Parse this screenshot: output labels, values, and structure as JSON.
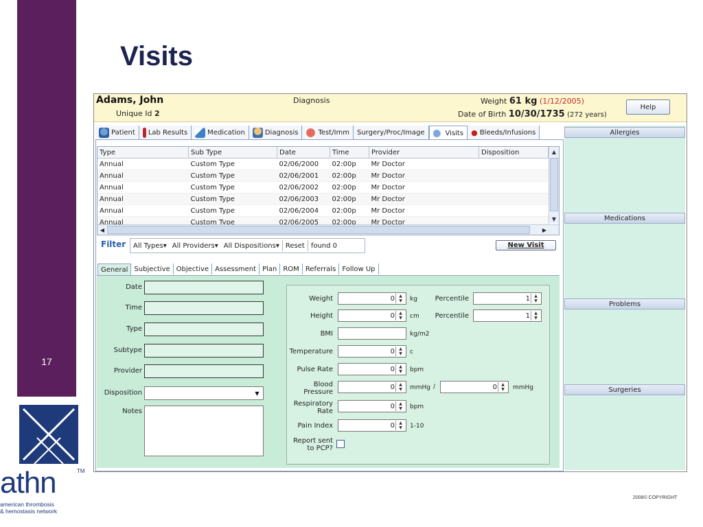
{
  "slide": {
    "title": "Visits",
    "slide_number": "17",
    "copyright": "2008© COPYRIGHT",
    "logo": {
      "word": "athn",
      "tm": "TM",
      "subtitle_line1": "american thrombosis",
      "subtitle_line2": "& hemostasis network"
    },
    "colors": {
      "side_band": "#5a1f5c",
      "title": "#1c2350",
      "logo": "#1e3a7a"
    }
  },
  "patient": {
    "name": "Adams, John",
    "unique_id_label": "Unique Id",
    "unique_id": "2",
    "diagnosis_label": "Diagnosis",
    "weight_label": "Weight",
    "weight": "61 kg",
    "weight_date": "(1/12/2005)",
    "dob_label": "Date of Birth",
    "dob": "10/30/1735",
    "age": "(272 years)",
    "help_button": "Help"
  },
  "tabs": [
    {
      "label": "Patient",
      "icon": "patient-icon",
      "color": "#3b6fb5"
    },
    {
      "label": "Lab Results",
      "icon": "lab-results-icon",
      "color": "#b52a2a"
    },
    {
      "label": "Medication",
      "icon": "medication-icon",
      "color": "#3f7fc9"
    },
    {
      "label": "Diagnosis",
      "icon": "diagnosis-icon",
      "color": "#d9a441"
    },
    {
      "label": "Test/Imm",
      "icon": "test-imm-icon",
      "color": "#d8453b"
    },
    {
      "label": "Surgery/Proc/Image",
      "icon": "",
      "color": ""
    },
    {
      "label": "Visits",
      "icon": "visits-icon",
      "color": "#4a78b8"
    },
    {
      "label": "Bleeds/Infusions",
      "icon": "blood-drop-icon",
      "color": "#c0221f"
    }
  ],
  "active_tab": "Visits",
  "visits_table": {
    "columns": [
      "Type",
      "Sub Type",
      "Date",
      "Time",
      "Provider",
      "Disposition"
    ],
    "rows": [
      [
        "Annual",
        "Custom Type",
        "02/06/2000",
        "02:00p",
        "Mr Doctor",
        ""
      ],
      [
        "Annual",
        "Custom Type",
        "02/06/2001",
        "02:00p",
        "Mr Doctor",
        ""
      ],
      [
        "Annual",
        "Custom Type",
        "02/06/2002",
        "02:00p",
        "Mr Doctor",
        ""
      ],
      [
        "Annual",
        "Custom Type",
        "02/06/2003",
        "02:00p",
        "Mr Doctor",
        ""
      ],
      [
        "Annual",
        "Custom Type",
        "02/06/2004",
        "02:00p",
        "Mr Doctor",
        ""
      ],
      [
        "Annual",
        "Custom Type",
        "02/06/2005",
        "02:00p",
        "Mr Doctor",
        ""
      ]
    ]
  },
  "filter": {
    "label": "Filter",
    "types": "All Types▾",
    "providers": "All Providers▾",
    "dispositions": "All Dispositions▾",
    "reset": "Reset",
    "found": "found 0",
    "new_visit": "New Visit"
  },
  "sub_tabs": [
    "General",
    "Subjective",
    "Objective",
    "Assessment",
    "Plan",
    "ROM",
    "Referrals",
    "Follow Up"
  ],
  "active_sub_tab": "General",
  "general_form": {
    "date_label": "Date",
    "time_label": "Time",
    "type_label": "Type",
    "subtype_label": "Subtype",
    "provider_label": "Provider",
    "disposition_label": "Disposition",
    "notes_label": "Notes",
    "date_value": "",
    "time_value": "",
    "type_value": "",
    "subtype_value": "",
    "provider_value": "",
    "disposition_value": "",
    "notes_value": ""
  },
  "vitals": {
    "weight_label": "Weight",
    "weight_value": "0",
    "weight_unit": "kg",
    "weight_percentile_label": "Percentile",
    "weight_percentile": "1",
    "height_label": "Height",
    "height_value": "0",
    "height_unit": "cm",
    "height_percentile_label": "Percentile",
    "height_percentile": "1",
    "bmi_label": "BMI",
    "bmi_value": "",
    "bmi_unit": "kg/m2",
    "temperature_label": "Temperature",
    "temperature_value": "0",
    "temperature_unit": "c",
    "pulse_label": "Pulse Rate",
    "pulse_value": "0",
    "pulse_unit": "bpm",
    "bp_label_line1": "Blood",
    "bp_label_line2": "Pressure",
    "bp_systolic": "0",
    "bp_unit": "mmHg",
    "bp_sep": "/",
    "bp_diastolic": "0",
    "bp_unit2": "mmHg",
    "resp_label_line1": "Respiratory",
    "resp_label_line2": "Rate",
    "resp_value": "0",
    "resp_unit": "bpm",
    "pain_label": "Pain Index",
    "pain_value": "0",
    "pain_unit": "1-10",
    "report_label_line1": "Report sent",
    "report_label_line2": "to PCP?",
    "report_checked": false
  },
  "right_panel": {
    "allergies": "Allergies",
    "medications": "Medications",
    "problems": "Problems",
    "surgeries": "Surgeries"
  }
}
